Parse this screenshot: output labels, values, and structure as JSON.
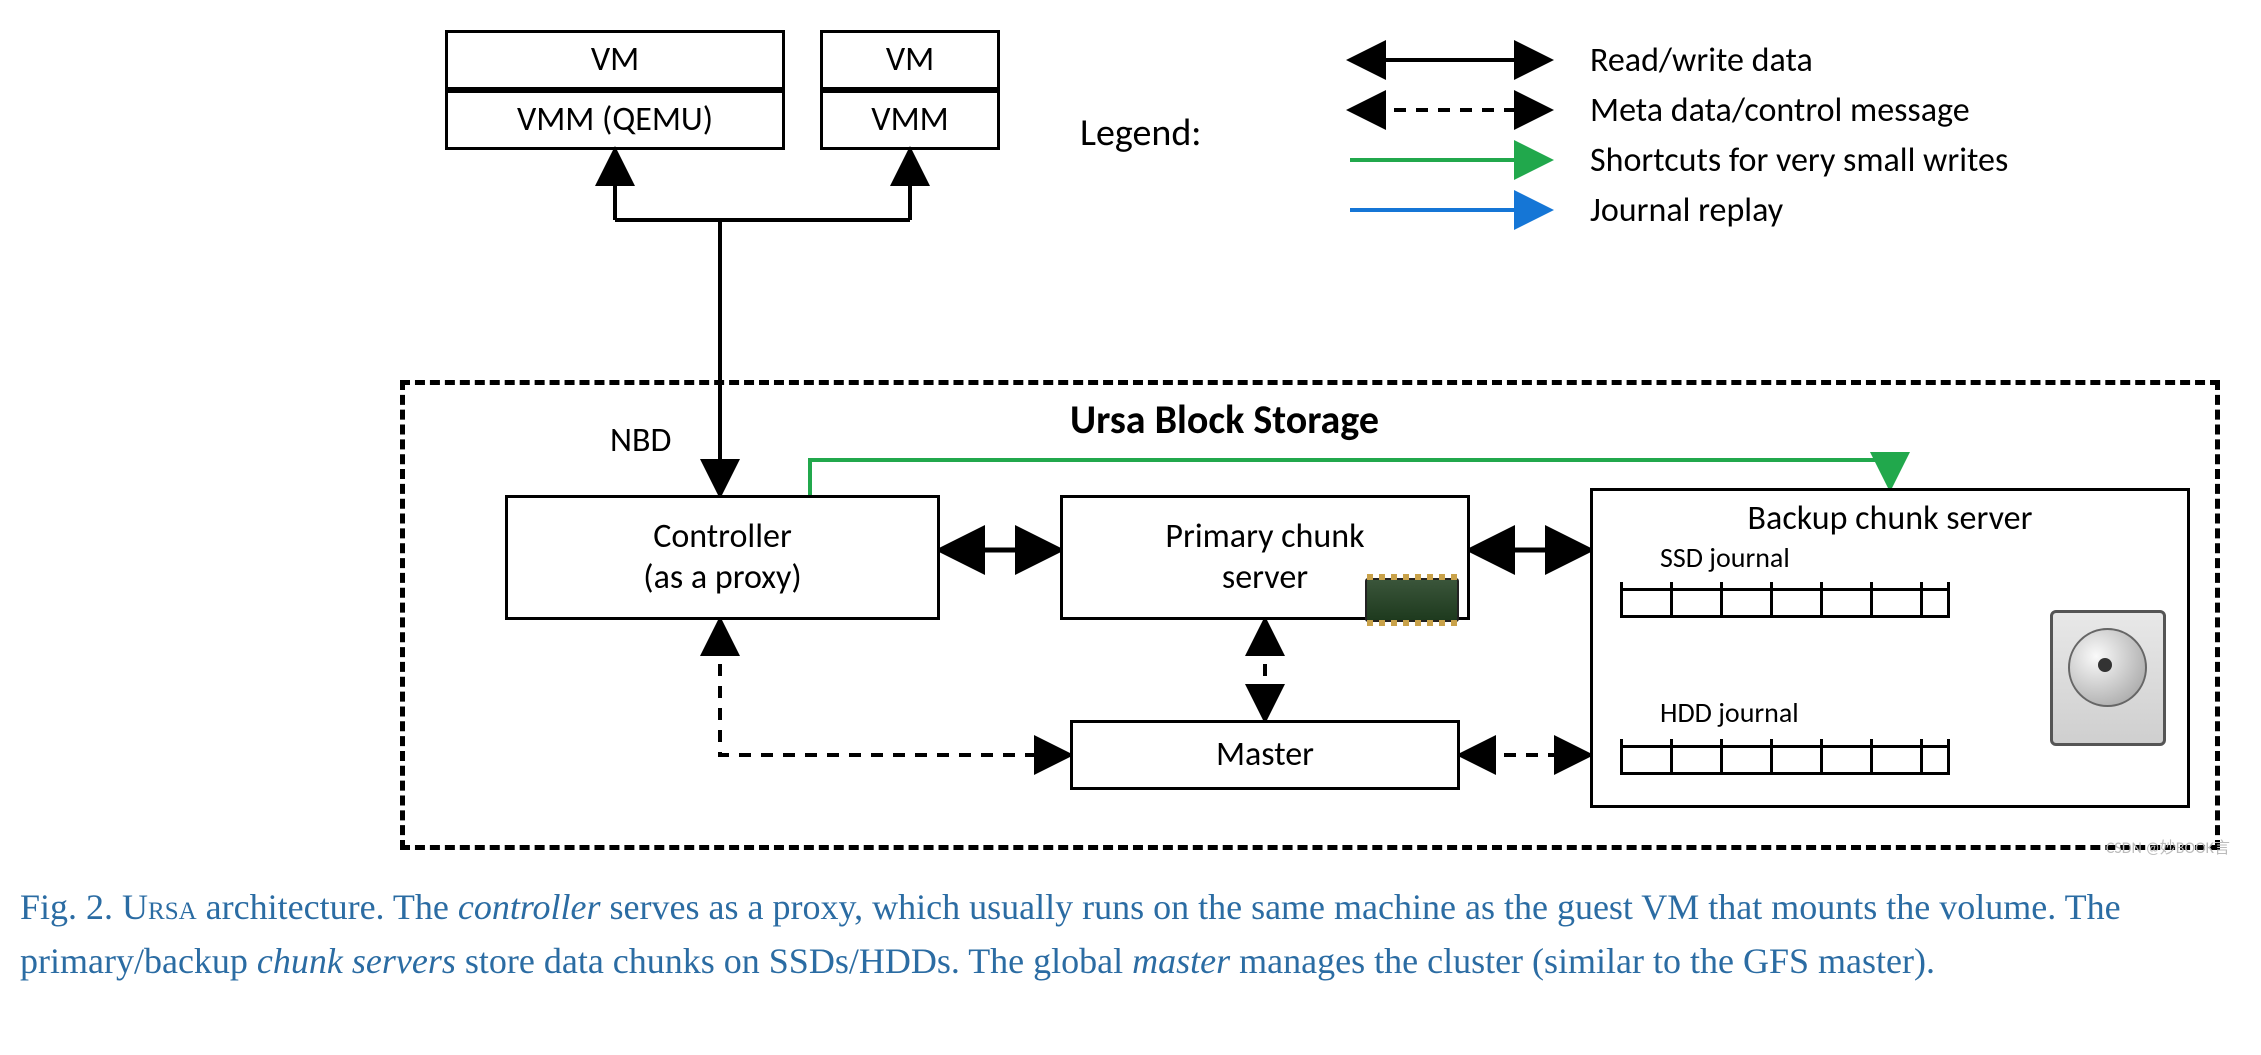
{
  "legend": {
    "label": "Legend:",
    "items": [
      "Read/write data",
      "Meta data/control message",
      "Shortcuts for very small writes",
      "Journal replay"
    ]
  },
  "vm_stack": {
    "vm1_top": "VM",
    "vm1_bottom": "VMM (QEMU)",
    "vm2_top": "VM",
    "vm2_bottom": "VMM"
  },
  "storage": {
    "title": "Ursa Block Storage",
    "nbd": "NBD",
    "controller": {
      "line1": "Controller",
      "line2": "(as a proxy)"
    },
    "primary": {
      "line1": "Primary chunk",
      "line2": "server"
    },
    "backup": {
      "title": "Backup chunk server",
      "ssd_journal": "SSD journal",
      "hdd_journal": "HDD journal"
    },
    "master": "Master"
  },
  "caption": {
    "prefix": "Fig. 2.  ",
    "ursa": "Ursa",
    "seg1": " architecture. The ",
    "controller": "controller",
    "seg2": " serves as a proxy, which usually runs on the same machine as the guest VM that mounts the volume. The primary/backup ",
    "chunkservers": "chunk servers",
    "seg3": " store data chunks on SSDs/HDDs. The global ",
    "master": "master",
    "seg4": " manages the cluster (similar to the GFS master)."
  },
  "watermark": "CSDN @妙BOOK言",
  "colors": {
    "green": "#21a84c",
    "blue": "#1576d6"
  }
}
